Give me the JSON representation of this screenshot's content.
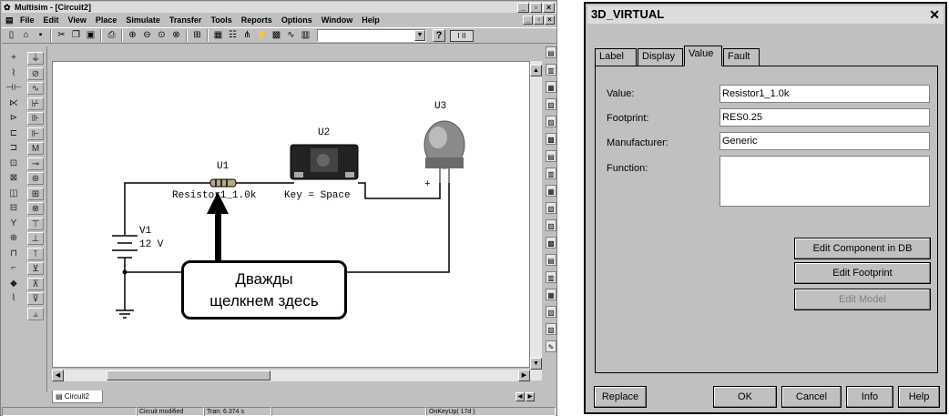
{
  "multisim": {
    "title": "Multisim - [Circuit2]",
    "menu": [
      "File",
      "Edit",
      "View",
      "Place",
      "Simulate",
      "Transfer",
      "Tools",
      "Reports",
      "Options",
      "Window",
      "Help"
    ],
    "help_label": "?",
    "sim_switch_label": "I  II",
    "toolbar_icons": [
      "new-icon",
      "open-icon",
      "save-icon",
      "cut-icon",
      "copy-icon",
      "paste-icon",
      "print-icon",
      "zoom-in-icon",
      "zoom-out-icon",
      "zoom-area-icon",
      "zoom-fit-icon",
      "hierarchy-icon",
      "spreadsheet-icon",
      "database-icon",
      "component-icon",
      "wizard-icon",
      "postprocessor-icon",
      "analysis-icon",
      "grapher-icon"
    ],
    "components": {
      "u1": {
        "ref": "U1",
        "value": "Resistor1_1.0k"
      },
      "u2": {
        "ref": "U2",
        "value": "Key = Space"
      },
      "u3": {
        "ref": "U3"
      },
      "v1": {
        "ref": "V1",
        "value": "12 V"
      },
      "plus_sign": "+"
    },
    "callout": {
      "line1": "Дважды",
      "line2": "щелкнем здесь"
    },
    "circuit_tab": "Circuit2",
    "status": {
      "left": "",
      "middle": "Circuit modified",
      "tran": "Tran: 6.374 s",
      "event": "OnKeyUp( 17d )"
    }
  },
  "dialog": {
    "title": "3D_VIRTUAL",
    "close_glyph": "✕",
    "tabs": [
      {
        "label": "Label",
        "active": false
      },
      {
        "label": "Display",
        "active": false
      },
      {
        "label": "Value",
        "active": true
      },
      {
        "label": "Fault",
        "active": false
      }
    ],
    "fields": {
      "value": {
        "label": "Value:",
        "text": "Resistor1_1.0k"
      },
      "footprint": {
        "label": "Footprint:",
        "text": "RES0.25"
      },
      "manufacturer": {
        "label": "Manufacturer:",
        "text": "Generic"
      },
      "function": {
        "label": "Function:",
        "text": ""
      }
    },
    "buttons": {
      "edit_component": "Edit Component in DB",
      "edit_footprint": "Edit Footprint",
      "edit_model": "Edit Model",
      "replace": "Replace",
      "ok": "OK",
      "cancel": "Cancel",
      "info": "Info",
      "help": "Help"
    }
  }
}
